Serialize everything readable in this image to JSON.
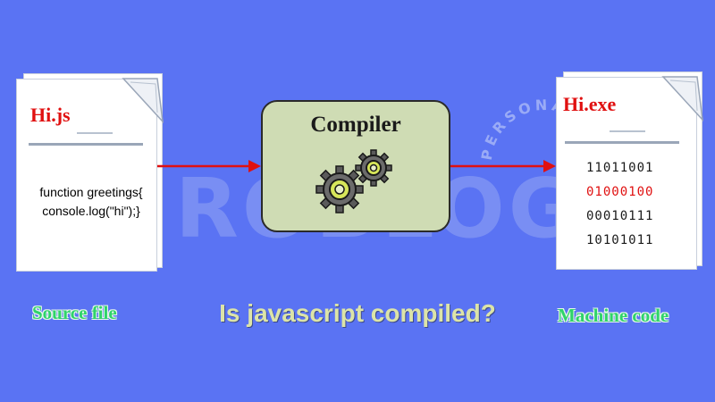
{
  "watermark": {
    "text": "ROBLOG",
    "arc_text": "PERSONAL BLOG"
  },
  "source_file": {
    "name": "Hi.js",
    "code_lines": [
      "function greetings{",
      "console.log(\"hi\");}"
    ],
    "caption": "Source file"
  },
  "compiler": {
    "label": "Compiler",
    "icon": "gears-icon"
  },
  "machine_file": {
    "name": "Hi.exe",
    "binary": [
      "11011001",
      "01000100",
      "00010111",
      "10101011"
    ],
    "caption": "Machine code"
  },
  "question": "Is javascript compiled?",
  "colors": {
    "background": "#5a73f3",
    "arrow": "#e01010",
    "title_red": "#e01010",
    "caption_green": "#2fd36a",
    "compiler_fill": "#cfdcb4",
    "question_text": "#dce4a8"
  }
}
